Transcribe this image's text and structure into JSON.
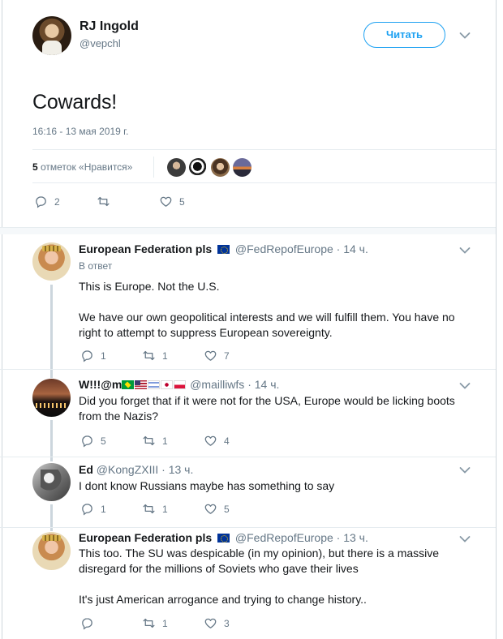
{
  "main_tweet": {
    "author_name": "RJ Ingold",
    "author_handle": "@vepchl",
    "follow_label": "Читать",
    "text": "Cowards!",
    "timestamp": "16:16 - 13 мая 2019 г.",
    "likes_count": "5",
    "likes_label": "отметок «Нравится»",
    "reply_count": "2",
    "retweet_count": "",
    "like_count": "5"
  },
  "replies": [
    {
      "name": "European Federation pls",
      "handle": "@FedRepofEurope",
      "time": "· 14 ч.",
      "in_reply": "В ответ",
      "paragraphs": [
        "This is Europe. Not the U.S.",
        "We have our own geopolitical interests and we will fulfill them. You have no right to attempt to suppress European sovereignty."
      ],
      "reply_count": "1",
      "retweet_count": "1",
      "like_count": "7"
    },
    {
      "name": "W!!!@m",
      "handle": "@mailliwfs",
      "time": "· 14 ч.",
      "paragraphs": [
        "Did you forget that if it were not for the USA, Europe would be licking boots from the Nazis?"
      ],
      "reply_count": "5",
      "retweet_count": "1",
      "like_count": "4"
    },
    {
      "name": "Ed",
      "handle": "@KongZXIII",
      "time": "· 13 ч.",
      "paragraphs": [
        "I dont know Russians maybe has something to say"
      ],
      "reply_count": "1",
      "retweet_count": "1",
      "like_count": "5"
    },
    {
      "name": "European Federation pls",
      "handle": "@FedRepofEurope",
      "time": "· 13 ч.",
      "paragraphs": [
        "This too. The SU was despicable (in my opinion), but there is a massive disregard for the millions of Soviets who gave their lives",
        "It's just American arrogance and trying to change history.."
      ],
      "reply_count": "",
      "retweet_count": "1",
      "like_count": "3"
    }
  ],
  "colors": {
    "accent": "#1da1f2",
    "secondary_text": "#657786",
    "thread_line": "#ccd6dd"
  },
  "icons": [
    "reply-icon",
    "retweet-icon",
    "like-icon",
    "chevron-down-icon",
    "eu-flag-icon"
  ]
}
